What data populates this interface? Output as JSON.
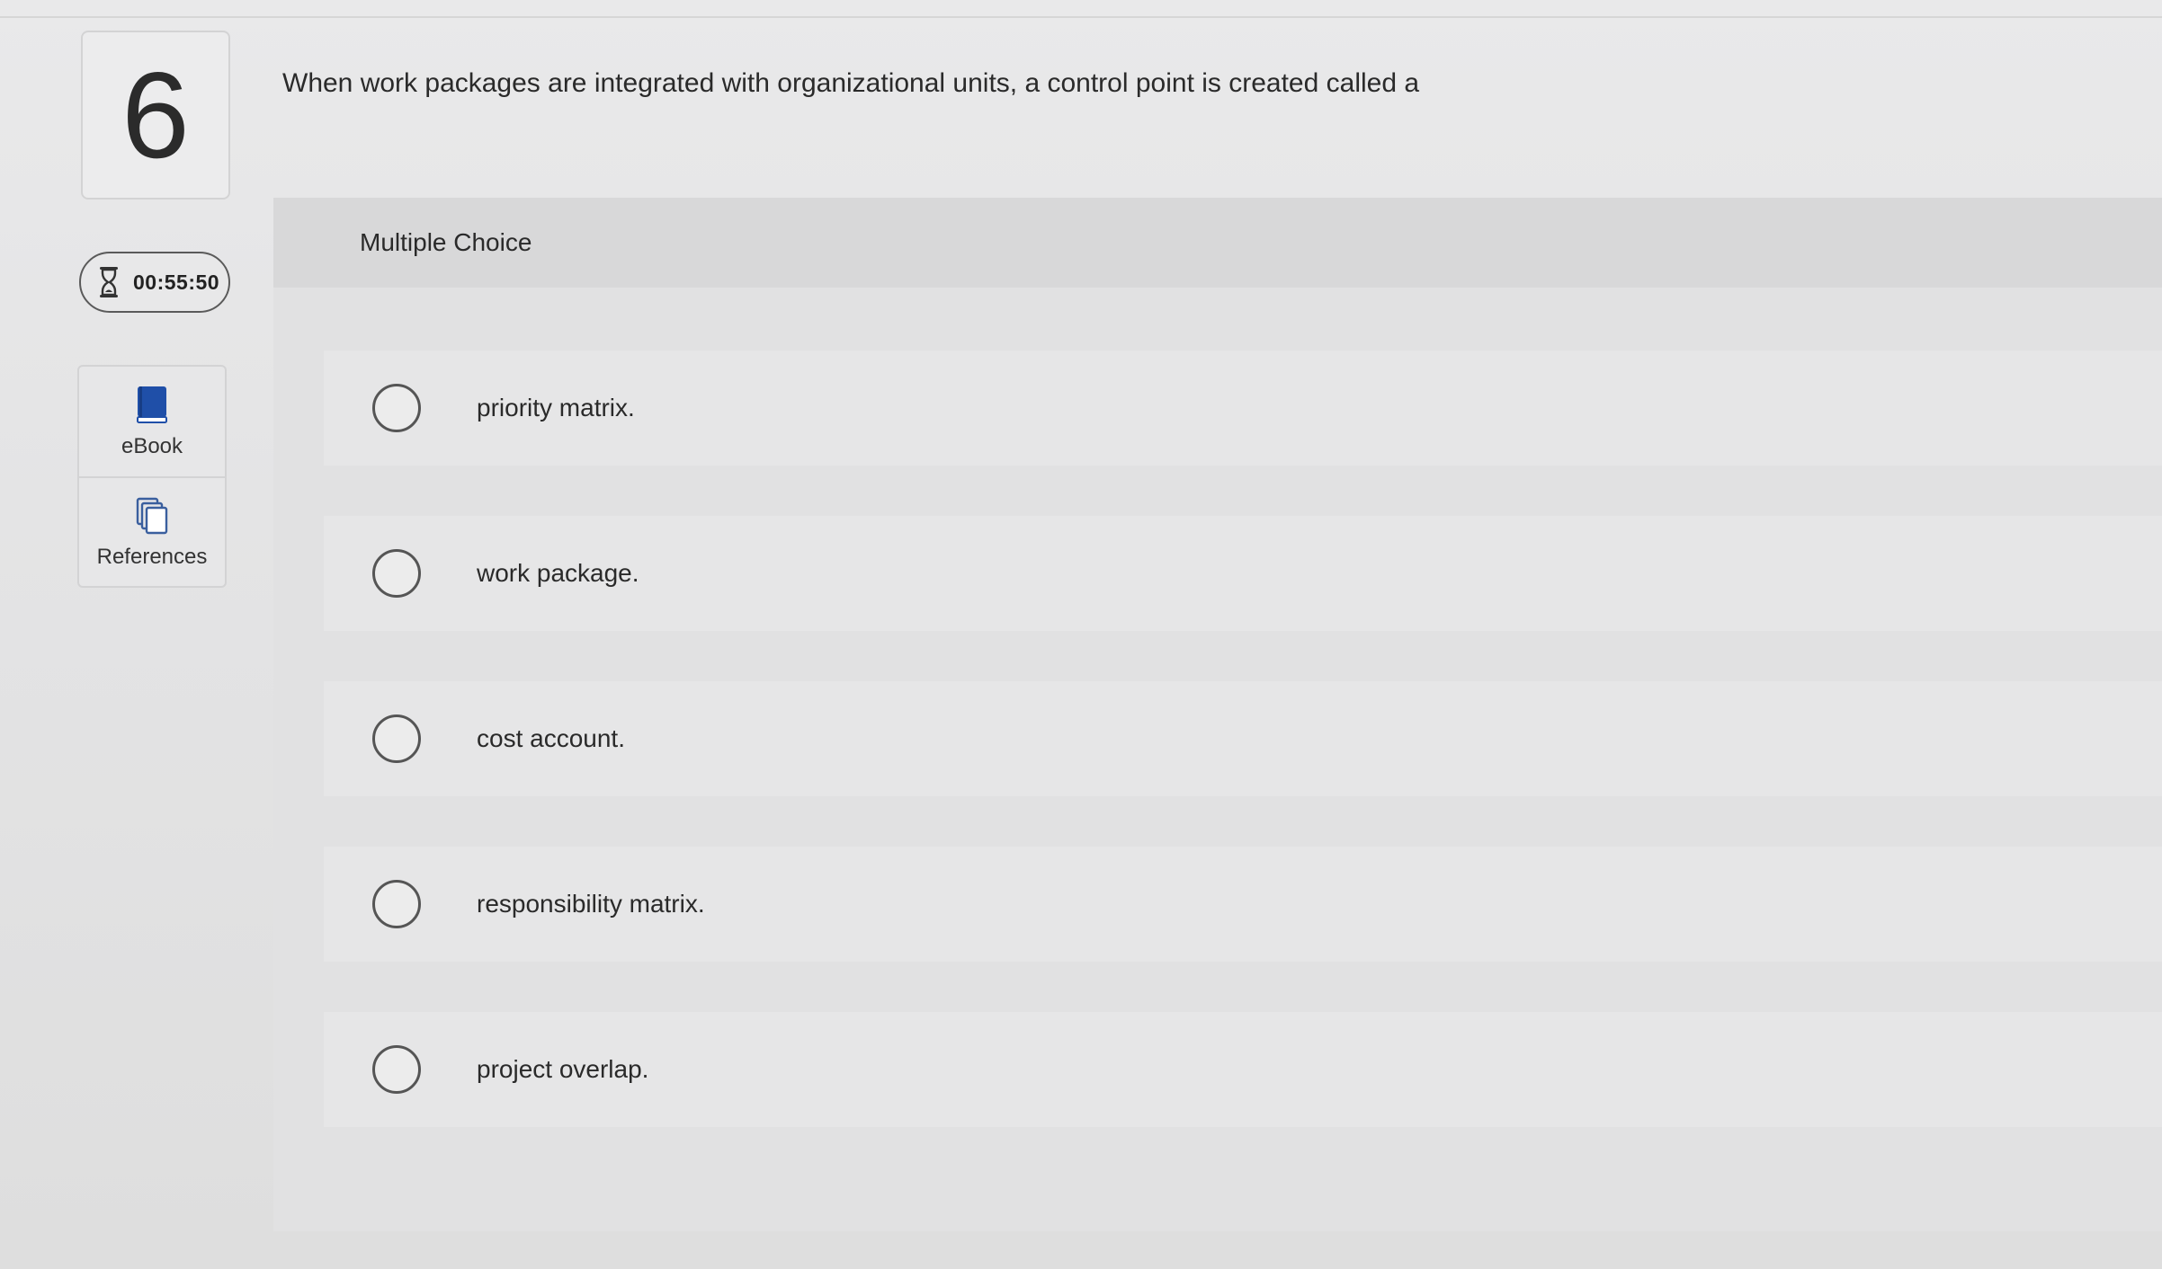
{
  "question": {
    "number": "6",
    "text": "When work packages are integrated with organizational units, a control point is created called a"
  },
  "timer": {
    "value": "00:55:50",
    "icon": "hourglass-icon"
  },
  "tools": [
    {
      "label": "eBook",
      "icon": "book-icon"
    },
    {
      "label": "References",
      "icon": "copy-pages-icon"
    }
  ],
  "answer": {
    "type_label": "Multiple Choice",
    "options": [
      {
        "label": "priority matrix."
      },
      {
        "label": "work package."
      },
      {
        "label": "cost account."
      },
      {
        "label": "responsibility matrix."
      },
      {
        "label": "project overlap."
      }
    ]
  },
  "colors": {
    "ebook_icon": "#1f4fa8",
    "background": "#e4e4e5",
    "radio_border": "#555555"
  }
}
